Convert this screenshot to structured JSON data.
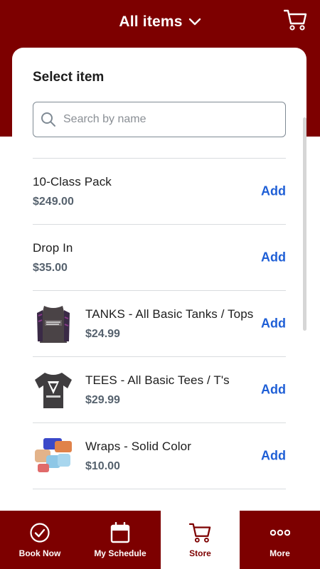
{
  "header": {
    "title": "All items",
    "title_icon": "chevron-down-icon",
    "cart_icon": "cart-icon"
  },
  "card": {
    "title": "Select item",
    "search": {
      "placeholder": "Search by name",
      "value": ""
    }
  },
  "items": [
    {
      "name": "10-Class Pack",
      "price": "$249.00",
      "action": "Add",
      "has_image": false
    },
    {
      "name": "Drop In",
      "price": "$35.00",
      "action": "Add",
      "has_image": false
    },
    {
      "name": "TANKS - All Basic Tanks / Tops",
      "price": "$24.99",
      "action": "Add",
      "has_image": true,
      "image": "tank-top-photo"
    },
    {
      "name": "TEES - All Basic Tees / T's",
      "price": "$29.99",
      "action": "Add",
      "has_image": true,
      "image": "tee-shirt-photo"
    },
    {
      "name": "Wraps - Solid Color",
      "price": "$10.00",
      "action": "Add",
      "has_image": true,
      "image": "hand-wraps-photo"
    }
  ],
  "bottom_nav": [
    {
      "label": "Book Now",
      "icon": "check-circle-icon",
      "active": false
    },
    {
      "label": "My Schedule",
      "icon": "calendar-icon",
      "active": false
    },
    {
      "label": "Store",
      "icon": "cart-icon",
      "active": true
    },
    {
      "label": "More",
      "icon": "more-dots-icon",
      "active": false
    }
  ],
  "colors": {
    "brand": "#7d0000",
    "link": "#1f5fd6",
    "price": "#56626e",
    "text": "#1d1d1d"
  }
}
